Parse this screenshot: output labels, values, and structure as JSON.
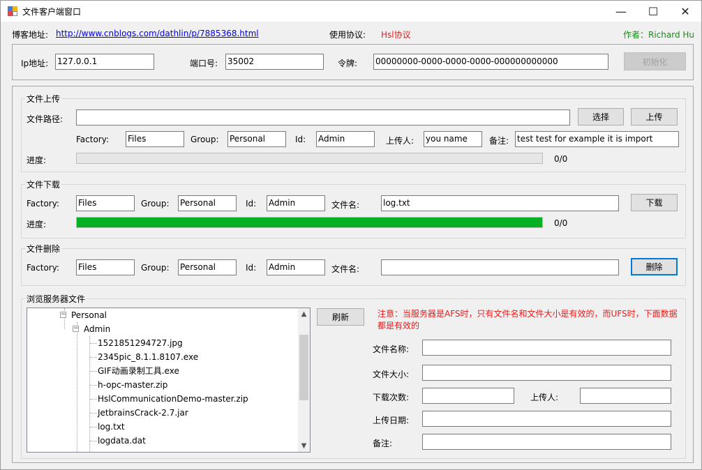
{
  "window": {
    "title": "文件客户端窗口",
    "minimize": "—",
    "maximize": "☐",
    "close": "✕"
  },
  "header": {
    "blog_label": "博客地址:",
    "blog_url": "http://www.cnblogs.com/dathlin/p/7885368.html",
    "protocol_label": "使用协议:",
    "protocol_value": "Hsl协议",
    "author": "作者：Richard Hu"
  },
  "connection": {
    "ip_label": "Ip地址:",
    "ip_value": "127.0.0.1",
    "port_label": "端口号:",
    "port_value": "35002",
    "token_label": "令牌:",
    "token_value": "00000000-0000-0000-0000-000000000000",
    "init_button": "初始化"
  },
  "upload": {
    "group_title": "文件上传",
    "path_label": "文件路径:",
    "path_value": "",
    "select_button": "选择",
    "upload_button": "上传",
    "factory_label": "Factory:",
    "factory_value": "Files",
    "group_label": "Group:",
    "group_value": "Personal",
    "id_label": "Id:",
    "id_value": "Admin",
    "uploader_label": "上传人:",
    "uploader_value": "you name",
    "remark_label": "备注:",
    "remark_value": "test test for example it is import",
    "progress_label": "进度:",
    "progress_text": "0/0",
    "progress_fraction": 0
  },
  "download": {
    "group_title": "文件下载",
    "factory_label": "Factory:",
    "factory_value": "Files",
    "group_label": "Group:",
    "group_value": "Personal",
    "id_label": "Id:",
    "id_value": "Admin",
    "filename_label": "文件名:",
    "filename_value": "log.txt",
    "download_button": "下载",
    "progress_label": "进度:",
    "progress_text": "0/0",
    "progress_fraction": 1.0
  },
  "delete": {
    "group_title": "文件删除",
    "factory_label": "Factory:",
    "factory_value": "Files",
    "group_label": "Group:",
    "group_value": "Personal",
    "id_label": "Id:",
    "id_value": "Admin",
    "filename_label": "文件名:",
    "filename_value": "",
    "delete_button": "删除"
  },
  "browse": {
    "group_title": "浏览服务器文件",
    "refresh_button": "刷新",
    "note": "注意：当服务器是AFS时，只有文件名和文件大小是有效的，而UFS时，下面数据都是有效的",
    "tree": {
      "root": "Personal",
      "folder": "Admin",
      "files": [
        "1521851294727.jpg",
        "2345pic_8.1.1.8107.exe",
        "GIF动画录制工具.exe",
        "h-opc-master.zip",
        "HslCommunicationDemo-master.zip",
        "JetbrainsCrack-2.7.jar",
        "log.txt",
        "logdata.dat"
      ]
    },
    "file_name_label": "文件名称:",
    "file_name_value": "",
    "file_size_label": "文件大小:",
    "file_size_value": "",
    "download_count_label": "下载次数:",
    "download_count_value": "",
    "uploader_label": "上传人:",
    "uploader_value": "",
    "upload_date_label": "上传日期:",
    "upload_date_value": "",
    "remark_label": "备注:",
    "remark_value": ""
  },
  "colors": {
    "progress_green": "#06b025",
    "note_red": "#e31c1c",
    "author_green": "#1a8a1a",
    "link_blue": "#0000ee"
  }
}
